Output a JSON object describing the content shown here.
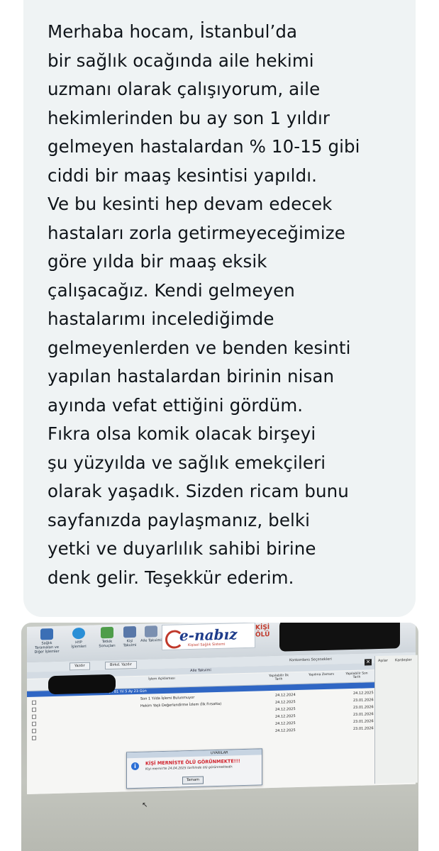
{
  "message": {
    "lines": [
      "Merhaba hocam, İstanbul’da",
      "bir sağlık ocağında aile hekimi",
      "uzmanı olarak çalışıyorum, aile",
      "hekimlerinden bu ay son 1 yıldır",
      "gelmeyen hastalardan % 10-15 gibi",
      "ciddi bir maaş kesintisi yapıldı.",
      "Ve bu kesinti hep devam edecek",
      "hastaları zorla getirmeyeceğimize",
      "göre yılda bir maaş eksik",
      "çalışacağız. Kendi gelmeyen",
      "hastalarımı incelediğimde",
      "gelmeyenlerden ve benden kesinti",
      "yapılan hastalardan birinin nisan",
      "ayında vefat ettiğini gördüm.",
      "Fıkra olsa komik olacak birşeyi",
      "şu yüzyılda ve sağlık emekçileri",
      "olarak yaşadık. Sizden ricam bunu",
      "sayfanızda paylaşmanız, belki",
      "yetki ve duyarlılık sahibi birine",
      "denk gelir. Teşekkür ederim."
    ]
  },
  "screenshot": {
    "toolbar": {
      "items": [
        "Sağlık Taramaları ve Diğer İşlemler",
        "HYP İşlemleri",
        "Tetkik Sonuçları",
        "Kişi Takvimi",
        "Aile Takvimi"
      ]
    },
    "logo": {
      "brand": "e-nabız",
      "subtitle": "Kişisel Sağlık Sistemi"
    },
    "status_badge": "KİŞİ ÖLÜ",
    "tabs": [
      "Yazdır",
      "Birkd. Yazdır"
    ],
    "right_label": "Konkordans Seçenekleri",
    "side_labels": [
      "Aşılar",
      "Kardeşler"
    ],
    "panel_title": "Aile Takvimi",
    "columns": [
      "İşlem Açıklaması",
      "Yapılabilir İlk Tarih",
      "Yapılma Zamanı",
      "Yapılabilir Son Tarih"
    ],
    "age_row": "Yaş : 81 Yıl 5 Ay 23 Gün",
    "rows": [
      {
        "desc": "Son 1 Yılda İşlemi Bulunmuyor",
        "first": "24.12.2024",
        "last": "24.12.2025"
      },
      {
        "desc": "Hekim Yaşlı Değerlendirme İzlem (İlk Fırsatta)",
        "first": "24.12.2025",
        "last": "23.01.2026"
      },
      {
        "desc": "",
        "first": "24.12.2025",
        "last": "23.01.2026"
      },
      {
        "desc": "",
        "first": "24.12.2025",
        "last": "23.01.2026"
      },
      {
        "desc": "",
        "first": "24.12.2025",
        "last": "23.01.2026"
      },
      {
        "desc": "",
        "first": "24.12.2025",
        "last": "23.01.2026"
      }
    ],
    "dialog": {
      "title": "UYARILAR",
      "heading": "KİŞİ MERNİSTE ÖLÜ GÖRÜNMEKTE!!!",
      "detail": "Kişi mernis'te 24.04.2025 tarihinde ölü görünmektedir.",
      "ok_label": "Tamam"
    }
  }
}
